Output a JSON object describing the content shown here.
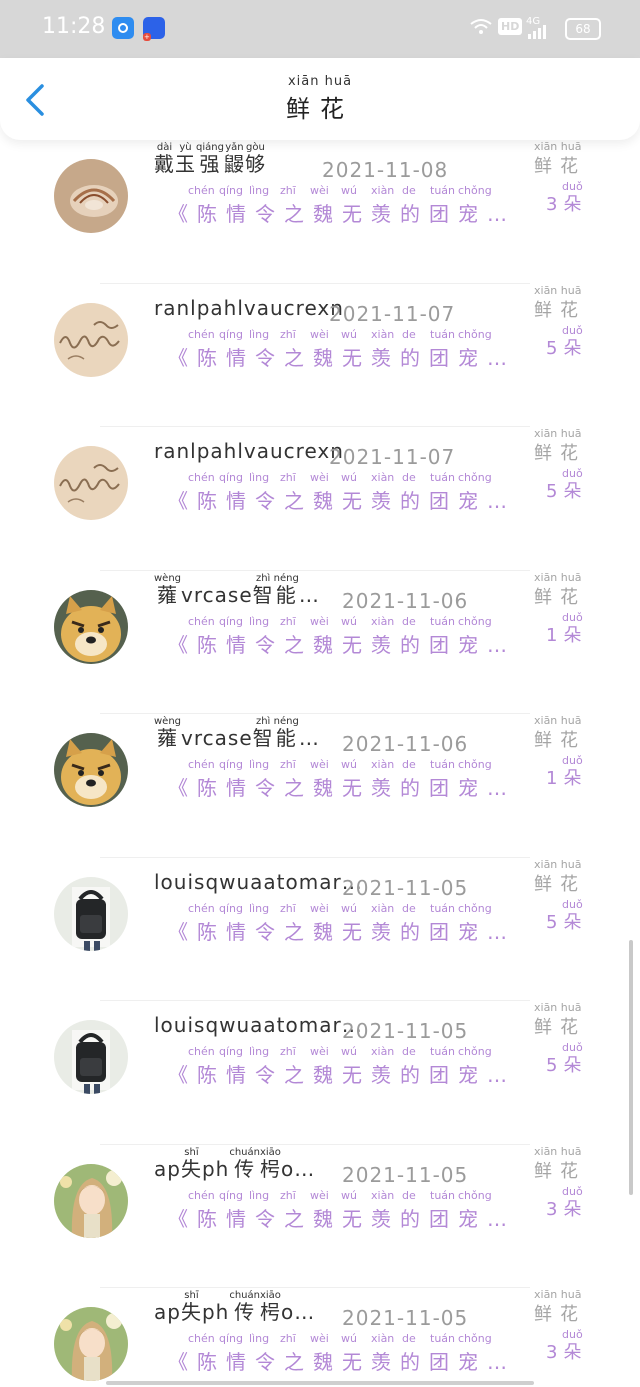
{
  "status_bar": {
    "time": "11:28",
    "network_hd": "HD",
    "network_4g": "4G",
    "battery": "68"
  },
  "header": {
    "title_pinyin": "xiān  huā",
    "title": "鲜花"
  },
  "labels": {
    "flower_pinyin": "xiān  huā",
    "flower": "鲜花",
    "count_pinyin": "duǒ",
    "count_unit": "朵"
  },
  "gift": {
    "pinyin": [
      "chén",
      "qíng",
      "lìng",
      "zhī",
      "wèi",
      "wú",
      "xiàn",
      "de",
      "tuán",
      "chǒng"
    ],
    "text": "《陈情令之魏无羡的团宠…"
  },
  "colors": {
    "accent_purple": "#b388d6",
    "back_blue": "#2a8fe0",
    "status_bar": "#d7d7d7"
  },
  "rows": [
    {
      "avatar": "seashell-avatar",
      "name_parts": [
        {
          "t": "戴",
          "p": "dài"
        },
        {
          "t": "玉",
          "p": "yù"
        },
        {
          "t": "强",
          "p": "qiáng"
        },
        {
          "t": "鼹",
          "p": "yǎn"
        },
        {
          "t": "够",
          "p": "gòu"
        }
      ],
      "name": "戴玉强鼹够",
      "date": "2021-11-08",
      "count": "3"
    },
    {
      "avatar": "sand-writing-avatar",
      "name_parts": [],
      "name": "ranlpahlvaucrexn",
      "date": "2021-11-07",
      "count": "5"
    },
    {
      "avatar": "sand-writing-avatar",
      "name_parts": [],
      "name": "ranlpahlvaucrexn",
      "date": "2021-11-07",
      "count": "5"
    },
    {
      "avatar": "doge-avatar",
      "name_parts": [
        {
          "t": "蕹",
          "p": "wèng"
        },
        {
          "t": "vrcase",
          "p": ""
        },
        {
          "t": "智",
          "p": "zhì"
        },
        {
          "t": "能",
          "p": "néng"
        },
        {
          "t": "…",
          "p": ""
        }
      ],
      "name": "蕹vrcase智能…",
      "date": "2021-11-06",
      "count": "1"
    },
    {
      "avatar": "doge-avatar",
      "name_parts": [
        {
          "t": "蕹",
          "p": "wèng"
        },
        {
          "t": "vrcase",
          "p": ""
        },
        {
          "t": "智",
          "p": "zhì"
        },
        {
          "t": "能",
          "p": "néng"
        },
        {
          "t": "…",
          "p": ""
        }
      ],
      "name": "蕹vrcase智能…",
      "date": "2021-11-06",
      "count": "1"
    },
    {
      "avatar": "backpack-avatar",
      "name_parts": [],
      "name": "louisqwuaatomar…",
      "date": "2021-11-05",
      "count": "5"
    },
    {
      "avatar": "backpack-avatar",
      "name_parts": [],
      "name": "louisqwuaatomar…",
      "date": "2021-11-05",
      "count": "5"
    },
    {
      "avatar": "anime-girl-avatar",
      "name_parts": [
        {
          "t": "ap",
          "p": ""
        },
        {
          "t": "失",
          "p": "shī"
        },
        {
          "t": "ph",
          "p": ""
        },
        {
          "t": "传",
          "p": "chuán"
        },
        {
          "t": "枵",
          "p": "xiāo"
        },
        {
          "t": "o…",
          "p": ""
        }
      ],
      "name": "ap失ph传枵o…",
      "date": "2021-11-05",
      "count": "3"
    },
    {
      "avatar": "anime-girl-avatar",
      "name_parts": [
        {
          "t": "ap",
          "p": ""
        },
        {
          "t": "失",
          "p": "shī"
        },
        {
          "t": "ph",
          "p": ""
        },
        {
          "t": "传",
          "p": "chuán"
        },
        {
          "t": "枵",
          "p": "xiāo"
        },
        {
          "t": "o…",
          "p": ""
        }
      ],
      "name": "ap失ph传枵o…",
      "date": "2021-11-05",
      "count": "3"
    }
  ]
}
